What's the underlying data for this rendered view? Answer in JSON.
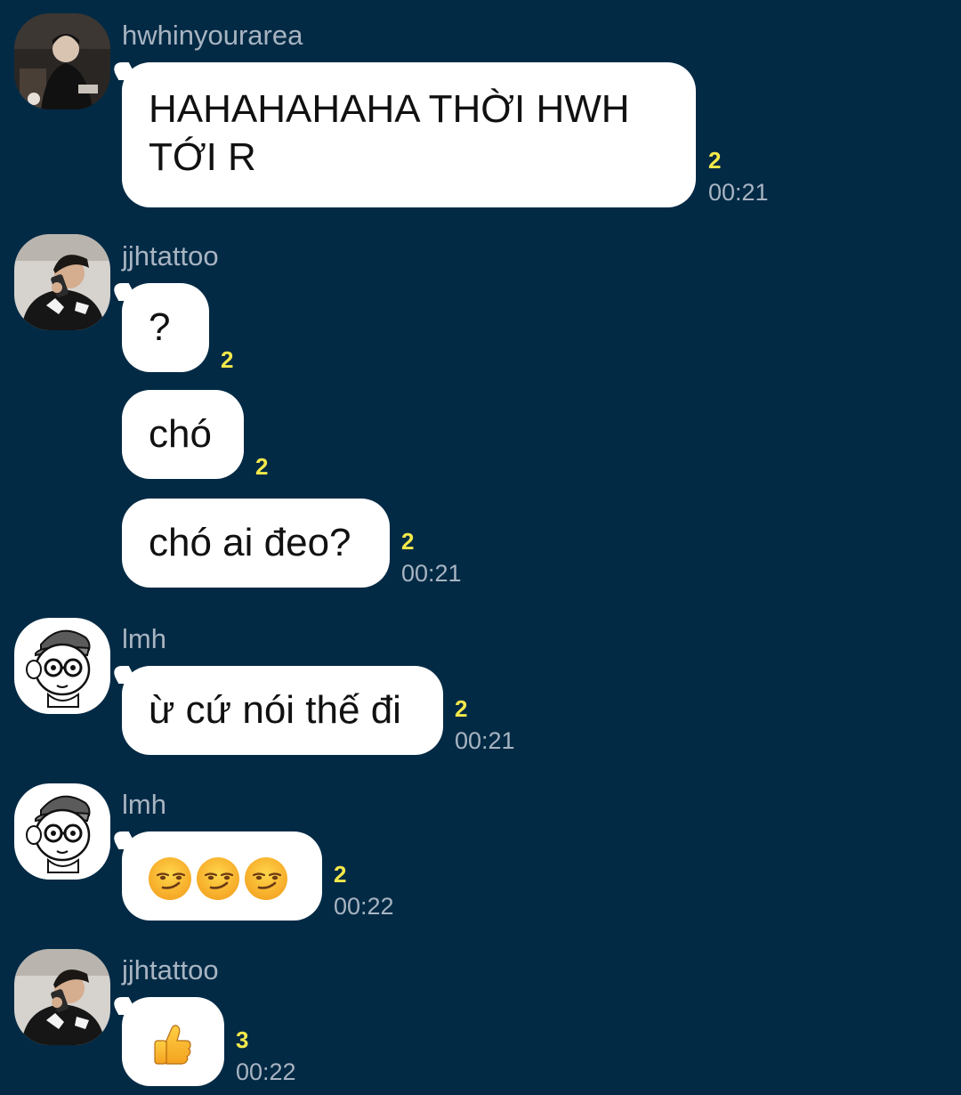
{
  "chat": {
    "messages": [
      {
        "sender": "hwhinyourarea",
        "avatar": "avatar-photo-dark",
        "text": "HAHAHAHAHA THỜI HWH\nTỚI R",
        "unread": "2",
        "time": "00:21"
      },
      {
        "sender": "jjhtattoo",
        "avatar": "avatar-photo-phone",
        "text": "?",
        "unread": "2"
      },
      {
        "text": "chó",
        "unread": "2"
      },
      {
        "text": "chó ai đeo?",
        "unread": "2",
        "time": "00:21"
      },
      {
        "sender": "lmh",
        "avatar": "avatar-cartoon-glasses",
        "text": "ừ cứ nói thế đi",
        "unread": "2",
        "time": "00:21"
      },
      {
        "sender": "lmh",
        "avatar": "avatar-cartoon-glasses",
        "emoji": [
          "smirking-face-emoji",
          "smirking-face-emoji",
          "smirking-face-emoji"
        ],
        "unread": "2",
        "time": "00:22"
      },
      {
        "sender": "jjhtattoo",
        "avatar": "avatar-photo-phone",
        "emoji": [
          "thumbs-up-emoji"
        ],
        "unread": "3",
        "time": "00:22"
      }
    ]
  },
  "colors": {
    "background": "#022a45",
    "bubble": "#ffffff",
    "unread": "#f4e84a",
    "meta_text": "#a8b4c1"
  }
}
